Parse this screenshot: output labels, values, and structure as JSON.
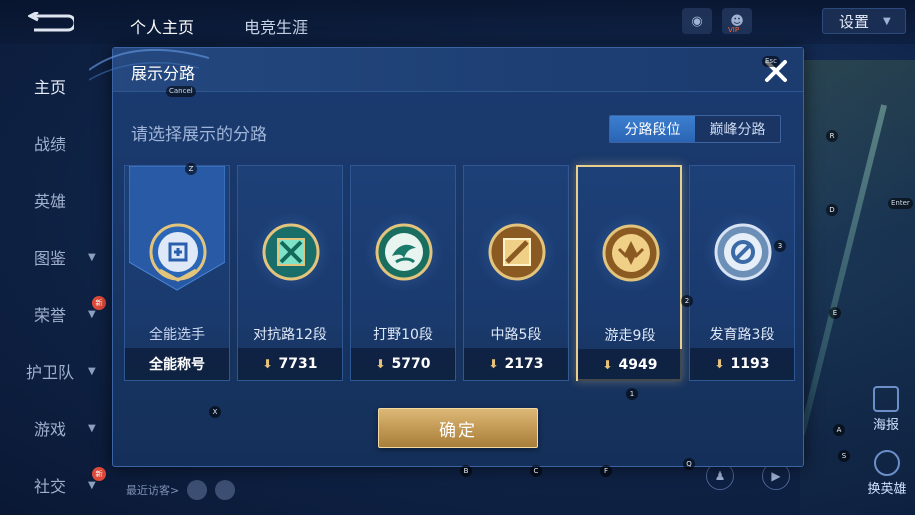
{
  "topbar": {
    "tabs": [
      "个人主页",
      "电竞生涯"
    ],
    "vip_label": "VIP",
    "settings_label": "设置"
  },
  "sidebar": {
    "items": [
      {
        "label": "主页",
        "active": true,
        "chevron": false,
        "new": false
      },
      {
        "label": "战绩",
        "active": false,
        "chevron": false,
        "new": false
      },
      {
        "label": "英雄",
        "active": false,
        "chevron": false,
        "new": false
      },
      {
        "label": "图鉴",
        "active": false,
        "chevron": true,
        "new": false
      },
      {
        "label": "荣誉",
        "active": false,
        "chevron": true,
        "new": true
      },
      {
        "label": "护卫队",
        "active": false,
        "chevron": true,
        "new": false
      },
      {
        "label": "游戏",
        "active": false,
        "chevron": true,
        "new": false
      },
      {
        "label": "社交",
        "active": false,
        "chevron": true,
        "new": true
      }
    ],
    "new_badge": "新"
  },
  "bottom": {
    "visitors_label": "最近访客>"
  },
  "right_panel": {
    "poster_label": "海报",
    "change_hero_label": "换英雄"
  },
  "modal": {
    "title": "展示分路",
    "subtitle": "请选择展示的分路",
    "segments": [
      {
        "label": "分路段位",
        "active": true
      },
      {
        "label": "巅峰分路",
        "active": false
      }
    ],
    "cards": [
      {
        "rank": "全能选手",
        "value": "全能称号",
        "icon": "allround-emblem-icon",
        "selected": false,
        "first": true
      },
      {
        "rank": "对抗路12段",
        "value": "7731",
        "icon": "clash-lane-emblem-icon",
        "selected": false,
        "first": false
      },
      {
        "rank": "打野10段",
        "value": "5770",
        "icon": "jungle-emblem-icon",
        "selected": false,
        "first": false
      },
      {
        "rank": "中路5段",
        "value": "2173",
        "icon": "mid-lane-emblem-icon",
        "selected": false,
        "first": false
      },
      {
        "rank": "游走9段",
        "value": "4949",
        "icon": "roam-emblem-icon",
        "selected": true,
        "first": false
      },
      {
        "rank": "发育路3段",
        "value": "1193",
        "icon": "farm-lane-emblem-icon",
        "selected": false,
        "first": false
      }
    ],
    "confirm_label": "确定"
  },
  "hints": {
    "esc": "Esc",
    "cancel": "Cancel",
    "enter": "Enter",
    "keys": [
      "Z",
      "X",
      "R",
      "D",
      "E",
      "3",
      "2",
      "1",
      "A",
      "S",
      "Q",
      "B",
      "C",
      "F"
    ]
  },
  "colors": {
    "modal_bg": "#1a3a6e",
    "accent_blue": "#3c7fd0",
    "gold": "#dcb877",
    "selected_border": "#e9cf8e"
  }
}
